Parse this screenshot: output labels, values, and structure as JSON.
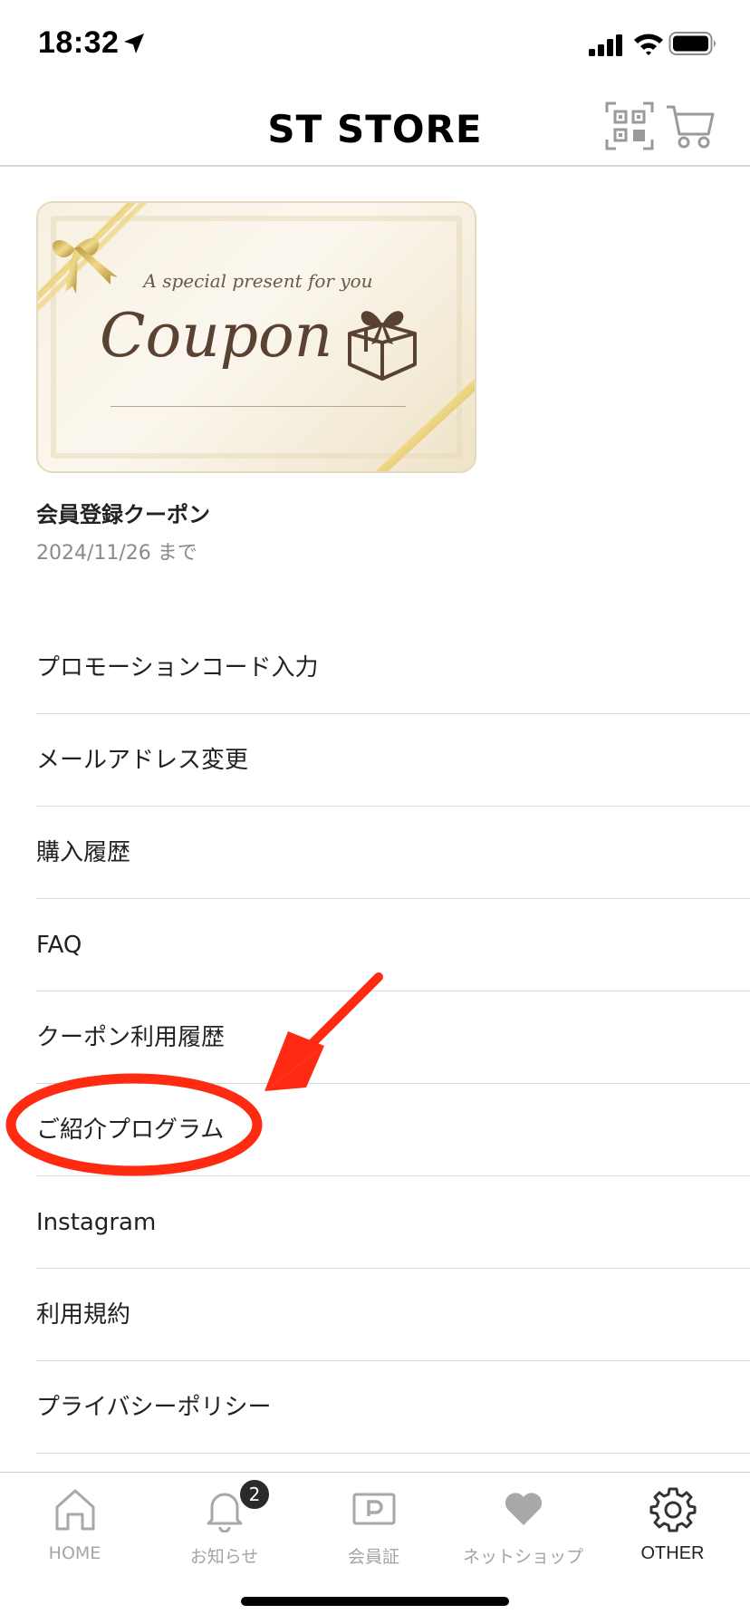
{
  "status_bar": {
    "time": "18:32"
  },
  "header": {
    "title": "ST STORE",
    "qr_icon": "qr-code-icon",
    "cart_icon": "cart-icon"
  },
  "coupon": {
    "image_tagline": "A special present for you",
    "image_word": "Coupon",
    "title": "会員登録クーポン",
    "expiry": "2024/11/26 まで"
  },
  "menu": {
    "items": [
      {
        "label": "プロモーションコード入力"
      },
      {
        "label": "メールアドレス変更"
      },
      {
        "label": "購入履歴"
      },
      {
        "label": "FAQ"
      },
      {
        "label": "クーポン利用履歴"
      },
      {
        "label": "ご紹介プログラム"
      },
      {
        "label": "Instagram"
      },
      {
        "label": "利用規約"
      },
      {
        "label": "プライバシーポリシー"
      }
    ]
  },
  "annotation": {
    "color": "#ff2a12",
    "highlighted_item": "ご紹介プログラム"
  },
  "tab_bar": {
    "tabs": [
      {
        "label": "HOME",
        "icon": "home-icon",
        "active": false
      },
      {
        "label": "お知らせ",
        "icon": "bell-icon",
        "active": false,
        "badge": "2"
      },
      {
        "label": "会員証",
        "icon": "member-card-icon",
        "active": false
      },
      {
        "label": "ネットショップ",
        "icon": "heart-icon",
        "active": false
      },
      {
        "label": "OTHER",
        "icon": "gear-icon",
        "active": true
      }
    ]
  }
}
